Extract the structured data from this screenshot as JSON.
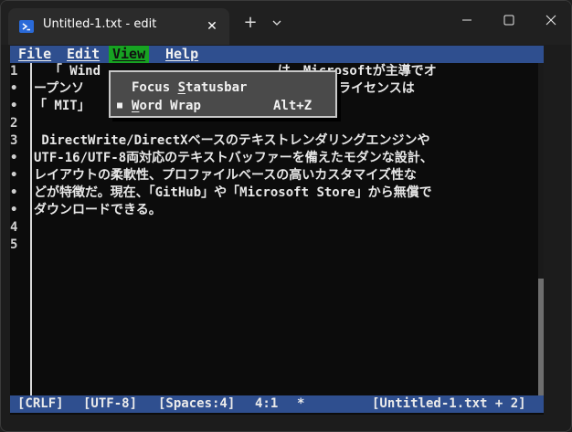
{
  "titlebar": {
    "tab_title": "Untitled-1.txt - edit",
    "close_tab_glyph": "✕",
    "new_tab_glyph": "+"
  },
  "menubar": {
    "items": [
      "File",
      "Edit",
      "View",
      "Help"
    ],
    "active": "View"
  },
  "dropdown": {
    "items": [
      {
        "before": "Focus ",
        "mnemonic": "S",
        "after": "tatusbar",
        "shortcut": "",
        "checked": false
      },
      {
        "before": "",
        "mnemonic": "W",
        "after": "ord Wrap",
        "shortcut": "Alt+Z",
        "checked": true
      }
    ],
    "check_glyph": "■"
  },
  "gutter": {
    "rows": [
      "1",
      "•",
      "•",
      "2",
      "3",
      "•",
      "•",
      "•",
      "•",
      "4",
      "5"
    ]
  },
  "editor": {
    "visible_lines": [
      "  「 Wind                       は、Microsoftが主導でオ",
      "ープンソ                       ナルアプリ（ライセンスは",
      "「 MIT」",
      "",
      " DirectWrite/DirectXベースのテキストレンダリングエンジンや",
      "UTF-16/UTF-8両対応のテキストバッファーを備えたモダンな設計、",
      "レイアウトの柔軟性、プロファイルベースの高いカスタマイズ性な",
      "どが特徴だ。現在、「GitHub」や「Microsoft Store」から無償で",
      "ダウンロードできる。",
      "",
      ""
    ]
  },
  "statusbar": {
    "line_ending": "[CRLF]",
    "encoding": "[UTF-8]",
    "indent": "[Spaces:4]",
    "position": "4:1",
    "modified": "*",
    "file": "[Untitled-1.txt + 2]"
  },
  "colors": {
    "menubar_bg": "#2f4f8f",
    "active_menu_bg": "#17a322",
    "terminal_bg": "#0c0c0c"
  }
}
